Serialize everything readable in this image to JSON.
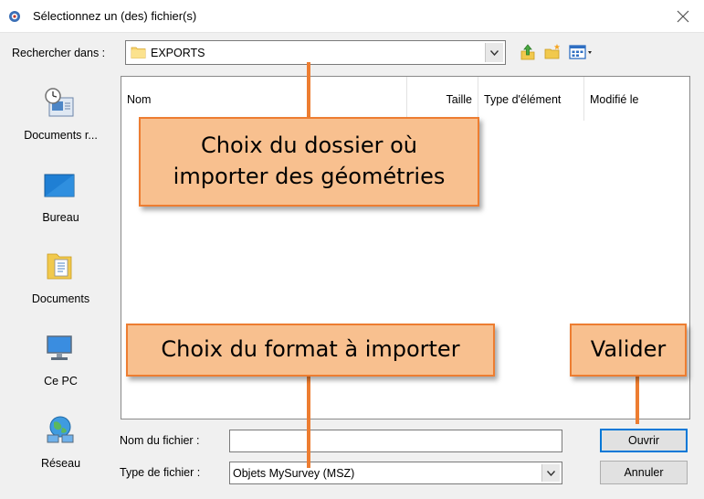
{
  "window": {
    "title": "Sélectionnez un (des) fichier(s)"
  },
  "lookin": {
    "label": "Rechercher dans :",
    "value": "EXPORTS"
  },
  "places": [
    {
      "label": "Documents r...",
      "icon": "recent-documents-icon"
    },
    {
      "label": "Bureau",
      "icon": "desktop-icon"
    },
    {
      "label": "Documents",
      "icon": "documents-folder-icon"
    },
    {
      "label": "Ce PC",
      "icon": "computer-icon"
    },
    {
      "label": "Réseau",
      "icon": "network-icon"
    }
  ],
  "filelist": {
    "columns": [
      "Nom",
      "Taille",
      "Type d'élément",
      "Modifié le"
    ]
  },
  "filename": {
    "label": "Nom du fichier :",
    "value": ""
  },
  "filetype": {
    "label": "Type de fichier :",
    "value": "Objets MySurvey (MSZ)"
  },
  "buttons": {
    "open": "Ouvrir",
    "cancel": "Annuler"
  },
  "annotations": {
    "folder": "Choix du dossier où importer des géométries",
    "format": "Choix du format à importer",
    "validate": "Valider"
  },
  "colors": {
    "callout_fill": "#f8c08f",
    "callout_border": "#ed7d31",
    "default_button_border": "#0078d7"
  }
}
